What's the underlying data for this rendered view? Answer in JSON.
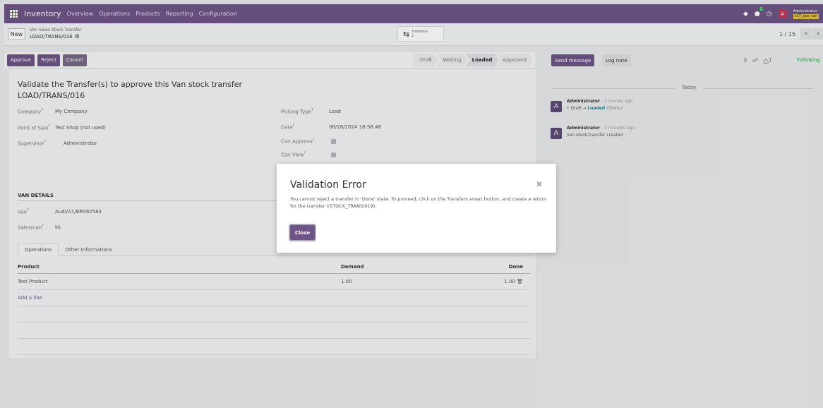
{
  "nav": {
    "brand": "Inventory",
    "menu": [
      "Overview",
      "Operations",
      "Products",
      "Reporting",
      "Configuration"
    ],
    "messages_count": "2",
    "user_initial": "A",
    "user_name": "Administrator",
    "db_name": "v17_pos_van"
  },
  "control_panel": {
    "new_label": "New",
    "breadcrumb_parent": "Van Sales Stock Transfer",
    "breadcrumb_current": "LOAD/TRANS/016",
    "smart_button_label": "Transfers",
    "smart_button_count": "1",
    "pager": "1 / 15"
  },
  "statusbar": {
    "buttons": [
      "Approve",
      "Reject",
      "Cancel"
    ],
    "stages": [
      "Draft",
      "Waiting",
      "Loaded",
      "Approved"
    ],
    "active_stage": "Loaded"
  },
  "form": {
    "title_line1": "Validate the Transfer(s) to approve this Van stock transfer",
    "title_line2": "LOAD/TRANS/016",
    "company_label": "Company",
    "company_value": "My Company",
    "pos_label": "Point of Sale",
    "pos_value": "Test Shop (not used)",
    "supervisor_label": "Supervisor",
    "supervisor_value": "Administrator",
    "picking_type_label": "Picking Type",
    "picking_type_value": "Load",
    "date_label": "Date",
    "date_value": "08/28/2024 18:58:48",
    "can_approve_label": "Can Approve",
    "can_view_label": "Can View",
    "van_details_title": "VAN DETAILS",
    "van_label": "Van",
    "van_value": "Audi/A1/BR092583",
    "salesman_label": "Salesman",
    "salesman_value": "kk",
    "tabs": [
      "Operations",
      "Other Informations"
    ],
    "table": {
      "headers": [
        "Product",
        "Demand",
        "Done"
      ],
      "rows": [
        {
          "product": "Test Product",
          "demand": "1.00",
          "done": "1.00"
        }
      ],
      "add_line": "Add a line"
    }
  },
  "chatter": {
    "send_message": "Send message",
    "log_note": "Log note",
    "followers_count": "1",
    "following": "Following",
    "today": "Today",
    "messages": [
      {
        "author": "Administrator",
        "time": "- 1 minute ago",
        "from": "Draft",
        "to": "Loaded",
        "field": "(Status)"
      },
      {
        "author": "Administrator",
        "time": "- 4 minutes ago",
        "body": "van.stock.transfer created"
      }
    ]
  },
  "dialog": {
    "title": "Validation Error",
    "message": "You cannot reject a transfer in 'Done' state. To proceed, click on the Transfers smart button, and create a return for the transfer (/STOCK_TRANS/019).",
    "close_label": "Close"
  },
  "colors": {
    "brand": "#6e5487",
    "following": "#28a745",
    "status_value": "#1a8a9c"
  }
}
